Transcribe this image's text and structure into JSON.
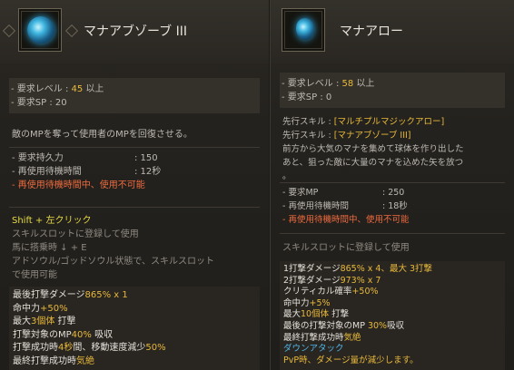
{
  "left": {
    "icon": "blue-mana-orb-icon",
    "title": "マナアブゾーブ III",
    "requirements": [
      {
        "label": "- 要求レベル : ",
        "value": "45",
        "suffix": " 以上"
      },
      {
        "label": "- 要求SP : ",
        "value": "20",
        "suffix": ""
      }
    ],
    "description": "敵のMPを奪って使用者のMPを回復させる。",
    "stats": [
      {
        "label": "- 要求持久力",
        "value": ": 150"
      },
      {
        "label": "- 再使用待機時間",
        "value": ": 12秒"
      }
    ],
    "cooldown_warning": "- 再使用待機時間中、使用不可能",
    "command": "Shift + 左クリック",
    "notes": [
      "スキルスロットに登録して使用",
      "馬に搭乗時 ↓ + E",
      "アドソウル/ゴッドソウル状態で、スキルスロット",
      "で使用可能"
    ],
    "effects": [
      [
        {
          "t": "最後打撃ダメージ",
          "c": "w"
        },
        {
          "t": "865% x 1",
          "c": "y"
        }
      ],
      [
        {
          "t": "命中力",
          "c": "w"
        },
        {
          "t": "+50%",
          "c": "y"
        }
      ],
      [
        {
          "t": "最大",
          "c": "w"
        },
        {
          "t": "3個体",
          "c": "y"
        },
        {
          "t": " 打撃",
          "c": "w"
        }
      ],
      [
        {
          "t": "打撃対象のMP",
          "c": "w"
        },
        {
          "t": "40%",
          "c": "y"
        },
        {
          "t": " 吸収",
          "c": "w"
        }
      ],
      [
        {
          "t": "打撃成功時",
          "c": "w"
        },
        {
          "t": "4秒",
          "c": "y"
        },
        {
          "t": "間、移動速度減少",
          "c": "w"
        },
        {
          "t": "50%",
          "c": "y"
        }
      ],
      [
        {
          "t": "最終打撃成功時",
          "c": "w"
        },
        {
          "t": "気絶",
          "c": "y"
        }
      ]
    ]
  },
  "right": {
    "icon": "mana-arrow-icon",
    "title": "マナアロー",
    "requirements": [
      {
        "label": "- 要求レベル : ",
        "value": "58",
        "suffix": " 以上"
      },
      {
        "label": "- 要求SP : ",
        "value": "0",
        "suffix": ""
      }
    ],
    "prereq": [
      {
        "label": "先行スキル : ",
        "value": "[マルチプルマジックアロー]"
      },
      {
        "label": "先行スキル : ",
        "value": "[マナアブゾーブ III]"
      }
    ],
    "description": [
      "前方から大気のマナを集めて球体を作り出した",
      "あと、狙った敵に大量のマナを込めた矢を放つ",
      "。"
    ],
    "stats": [
      {
        "label": "- 要求MP",
        "value": ": 250"
      },
      {
        "label": "- 再使用待機時間",
        "value": ": 18秒"
      }
    ],
    "cooldown_warning": "- 再使用待機時間中、使用不可能",
    "usage": "スキルスロットに登録して使用",
    "effects": [
      [
        {
          "t": "1打撃ダメージ",
          "c": "w"
        },
        {
          "t": "865% x 4、最大 3打撃",
          "c": "y"
        }
      ],
      [
        {
          "t": "2打撃ダメージ",
          "c": "w"
        },
        {
          "t": "973% x 7",
          "c": "y"
        }
      ],
      [
        {
          "t": "クリティカル確率",
          "c": "w"
        },
        {
          "t": "+50%",
          "c": "y"
        }
      ],
      [
        {
          "t": "命中力",
          "c": "w"
        },
        {
          "t": "+5%",
          "c": "y"
        }
      ],
      [
        {
          "t": "最大",
          "c": "w"
        },
        {
          "t": "10個体",
          "c": "y"
        },
        {
          "t": " 打撃",
          "c": "w"
        }
      ],
      [
        {
          "t": "最後の打撃対象のMP ",
          "c": "w"
        },
        {
          "t": "30%",
          "c": "y"
        },
        {
          "t": "吸収",
          "c": "w"
        }
      ],
      [
        {
          "t": "最終打撃成功時",
          "c": "w"
        },
        {
          "t": "気絶",
          "c": "y"
        }
      ],
      [
        {
          "t": "ダウンアタック",
          "c": "c"
        }
      ],
      [
        {
          "t": "PvP時、ダメージ量が減少します。",
          "c": "y"
        }
      ]
    ]
  }
}
